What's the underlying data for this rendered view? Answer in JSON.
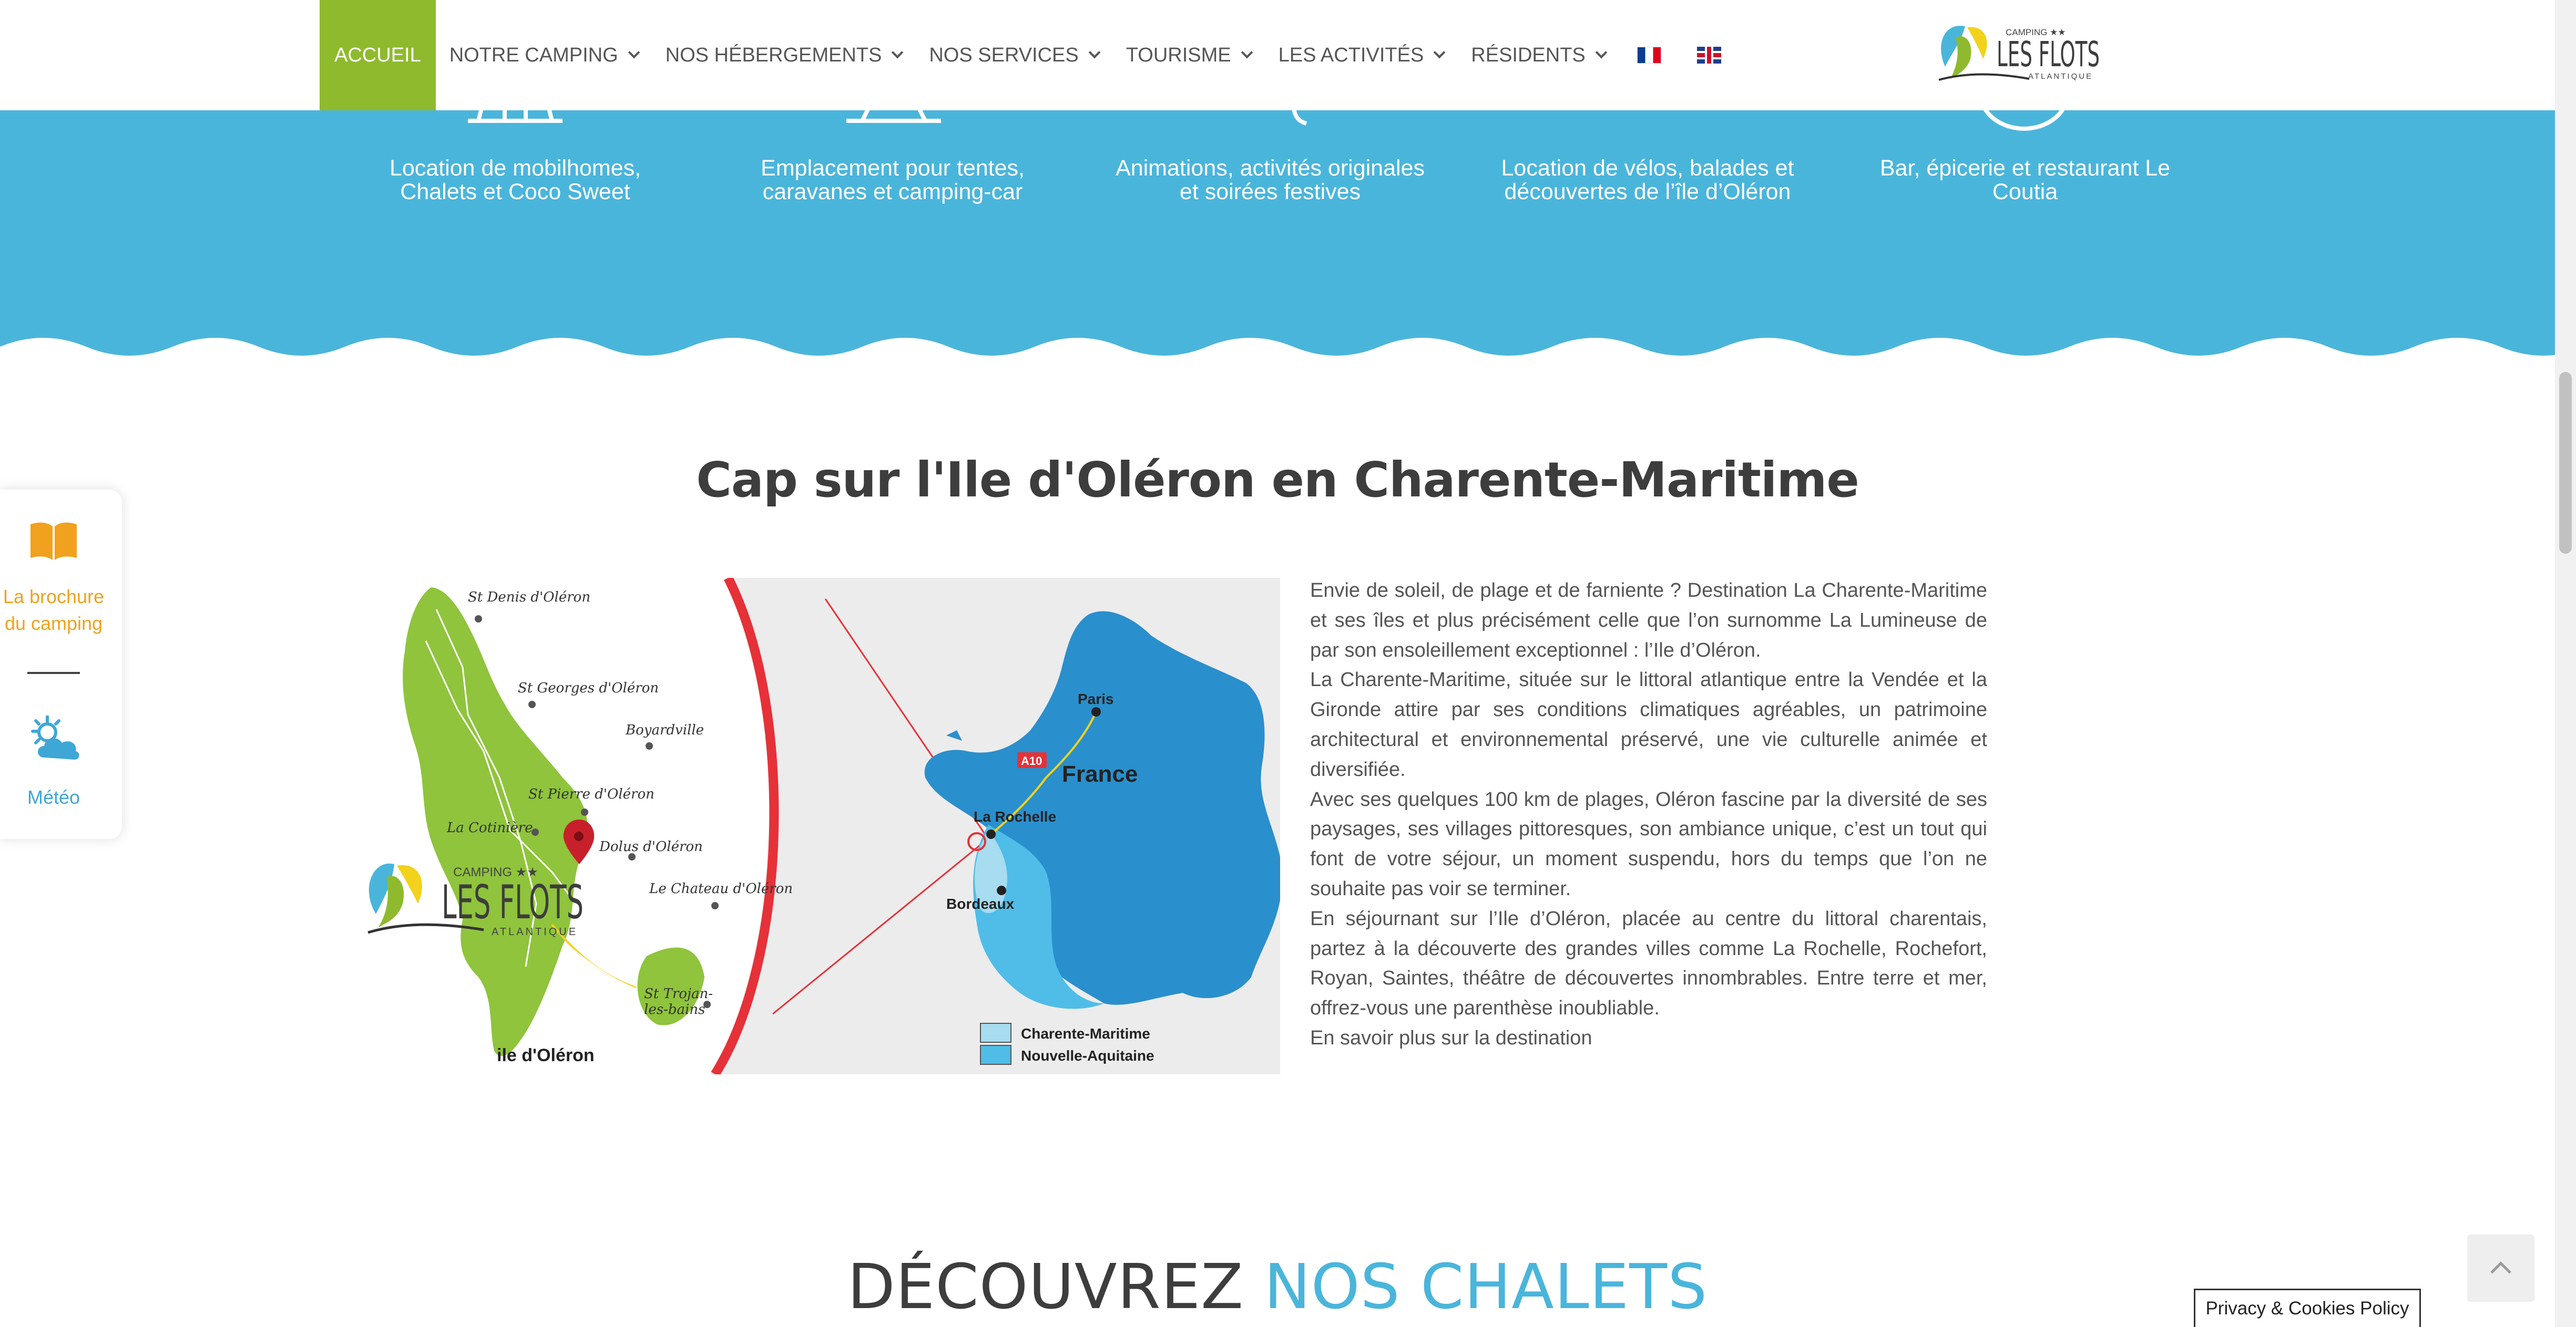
{
  "nav": {
    "items": [
      {
        "label": "ACCUEIL",
        "active": true
      },
      {
        "label": "NOTRE CAMPING"
      },
      {
        "label": "NOS HÉBERGEMENTS"
      },
      {
        "label": "NOS SERVICES"
      },
      {
        "label": "TOURISME"
      },
      {
        "label": "LES ACTIVITÉS"
      },
      {
        "label": "RÉSIDENTS"
      }
    ],
    "flags": [
      "fr-flag-icon",
      "uk-flag-icon"
    ]
  },
  "logo": {
    "top": "CAMPING ★★",
    "main": "LES FLOTS",
    "sub": "ATLANTIQUE"
  },
  "services": [
    {
      "line1": "Location de mobilhomes,",
      "line2": "Chalets et Coco Sweet"
    },
    {
      "line1": "Emplacement pour tentes,",
      "line2": "caravanes et camping-car"
    },
    {
      "line1": "Animations, activités originales",
      "line2": "et soirées festives"
    },
    {
      "line1": "Location de vélos, balades et",
      "line2": "découvertes de l’île d’Oléron"
    },
    {
      "line1": "Bar, épicerie et restaurant Le",
      "line2": "Coutia"
    }
  ],
  "section": {
    "title": "Cap sur l'Ile d'Oléron en Charente-Maritime"
  },
  "map": {
    "towns": [
      "St Denis d'Oléron",
      "St Georges d'Oléron",
      "Boyardville",
      "St Pierre d'Oléron",
      "La Cotinière",
      "Dolus d'Oléron",
      "Le Chateau d'Oléron",
      "St Trojan-",
      "les-bains"
    ],
    "island_label": "ile d'Oléron",
    "france": {
      "country": "France",
      "paris": "Paris",
      "la_rochelle": "La Rochelle",
      "bordeaux": "Bordeaux",
      "road": "A10"
    },
    "legend": [
      "Charente-Maritime",
      "Nouvelle-Aquitaine"
    ],
    "colors": {
      "island": "#8fc43c",
      "france": "#2a8fcd",
      "aquitaine": "#4fbde8",
      "charente": "#a7dcf1",
      "arc": "#e63138"
    }
  },
  "text": {
    "paragraphs": [
      "Envie de soleil, de plage et de farniente ? Destination La Charente-Maritime et ses îles et plus précisément celle que l’on surnomme La Lumineuse de par son ensoleillement exceptionnel : l’Ile d’Oléron.",
      "La Charente-Maritime, située sur le littoral atlantique entre la Vendée et la Gironde attire par ses conditions climatiques agréables, un patrimoine architectural et environnemental préservé, une vie culturelle animée et diversifiée.",
      "Avec ses quelques 100 km de plages, Oléron fascine par la diversité de ses paysages, ses villages pittoresques, son ambiance unique, c’est un tout qui font de votre séjour, un moment suspendu, hors du temps que l’on ne souhaite pas voir se terminer.",
      "En séjournant sur l’Ile d’Oléron, placée au centre du littoral charentais, partez à la découverte des grandes villes comme La Rochelle, Rochefort, Royan, Saintes, théâtre de découvertes innombrables. Entre terre et mer, offrez-vous une parenthèse inoubliable."
    ],
    "link": "En savoir plus sur la destination"
  },
  "sidebar": {
    "brochure_line1": "La brochure",
    "brochure_line2": "du camping",
    "meteo": "Météo",
    "colors": {
      "brochure": "#f0a21e",
      "meteo": "#3fa7d6"
    }
  },
  "discover": {
    "part1": "DÉCOUVREZ ",
    "part2": "NOS CHALETS"
  },
  "footer": {
    "privacy": "Privacy & Cookies Policy"
  },
  "colors": {
    "accent_green": "#8fba2e",
    "band_blue": "#4ab5db"
  }
}
